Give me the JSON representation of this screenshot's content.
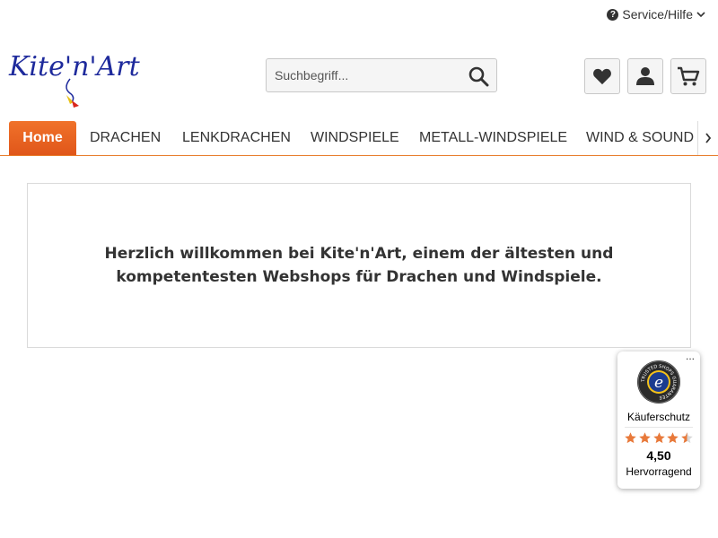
{
  "header": {
    "service_label": "Service/Hilfe",
    "logo_text": "Kite'n'Art"
  },
  "search": {
    "placeholder": "Suchbegriff..."
  },
  "icons": {
    "wishlist": "heart-icon",
    "account": "user-icon",
    "cart": "cart-icon"
  },
  "nav": {
    "items": [
      {
        "label": "Home",
        "active": true
      },
      {
        "label": "DRACHEN"
      },
      {
        "label": "LENKDRACHEN"
      },
      {
        "label": "WINDSPIELE"
      },
      {
        "label": "METALL-WINDSPIELE"
      },
      {
        "label": "WIND & SOUND"
      }
    ]
  },
  "main": {
    "welcome_text": "Herzlich willkommen bei Kite'n'Art, einem der ältesten und kompetentesten Webshops für Drachen und Windspiele."
  },
  "trusted_shops": {
    "seal_text": "TRUSTED SHOPS GUARANTEE",
    "kaeuferschutz": "Käuferschutz",
    "rating": 4.5,
    "rating_text": "4,50",
    "rating_label": "Hervorragend",
    "more": "..."
  },
  "colors": {
    "accent": "#e8682a",
    "star": "#e8793a",
    "logo_blue": "#1e2a9c"
  }
}
